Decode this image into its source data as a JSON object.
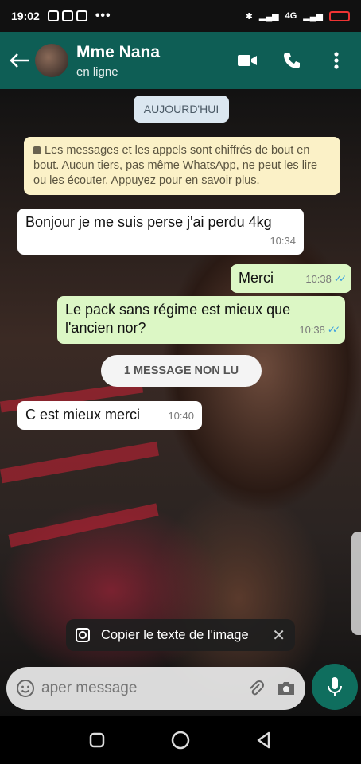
{
  "status": {
    "time": "19:02",
    "network": "4G"
  },
  "header": {
    "name": "Mme Nana",
    "status": "en ligne"
  },
  "chat": {
    "date_chip": "AUJOURD'HUI",
    "notice": "Les messages et les appels sont chiffrés de bout en bout. Aucun tiers, pas même WhatsApp, ne peut les lire ou les écouter. Appuyez pour en savoir plus.",
    "messages": [
      {
        "dir": "in",
        "text": "Bonjour je me suis perse j'ai perdu 4kg",
        "time": "10:34"
      },
      {
        "dir": "out",
        "text": "Merci",
        "time": "10:38"
      },
      {
        "dir": "out",
        "text": "Le pack sans régime est mieux que l'ancien nor?",
        "time": "10:38"
      },
      {
        "dir": "in",
        "text": "C est mieux merci",
        "time": "10:40"
      }
    ],
    "unread_label": "1 MESSAGE NON LU"
  },
  "lens": {
    "label": "Copier le texte de l'image"
  },
  "composer": {
    "placeholder": "aper message"
  },
  "icons": {
    "back": "back-arrow-icon",
    "video": "video-call-icon",
    "call": "phone-icon",
    "menu": "more-vert-icon",
    "emoji": "emoji-icon",
    "camera": "camera-icon",
    "mic": "mic-icon"
  },
  "colors": {
    "header": "#0e5e55",
    "outgoing": "#dcf7c5",
    "incoming": "#ffffff",
    "notice": "#fbf1c7",
    "mic": "#0f6e5e"
  }
}
